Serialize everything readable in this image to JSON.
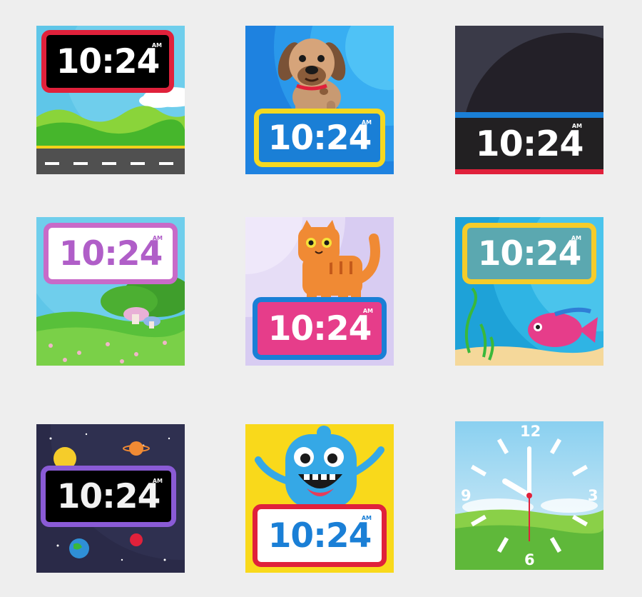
{
  "time": "10:24",
  "ampm": "AM",
  "dial": {
    "n12": "12",
    "n3": "3",
    "n6": "6",
    "n9": "9"
  },
  "faces": [
    {
      "theme": "road-hills",
      "accent": "#e0213b"
    },
    {
      "theme": "puppy",
      "accent": "#f5d820"
    },
    {
      "theme": "dark-planet",
      "accent": "#1a7fd6"
    },
    {
      "theme": "mushroom-meadow",
      "accent": "#c86ac8"
    },
    {
      "theme": "orange-cat",
      "accent": "#e63d8a"
    },
    {
      "theme": "aquarium-fish",
      "accent": "#f5cc2a"
    },
    {
      "theme": "outer-space",
      "accent": "#8a5bd6"
    },
    {
      "theme": "blue-monster",
      "accent": "#e0213b"
    },
    {
      "theme": "analog-meadow",
      "accent": "#e0213b"
    }
  ]
}
